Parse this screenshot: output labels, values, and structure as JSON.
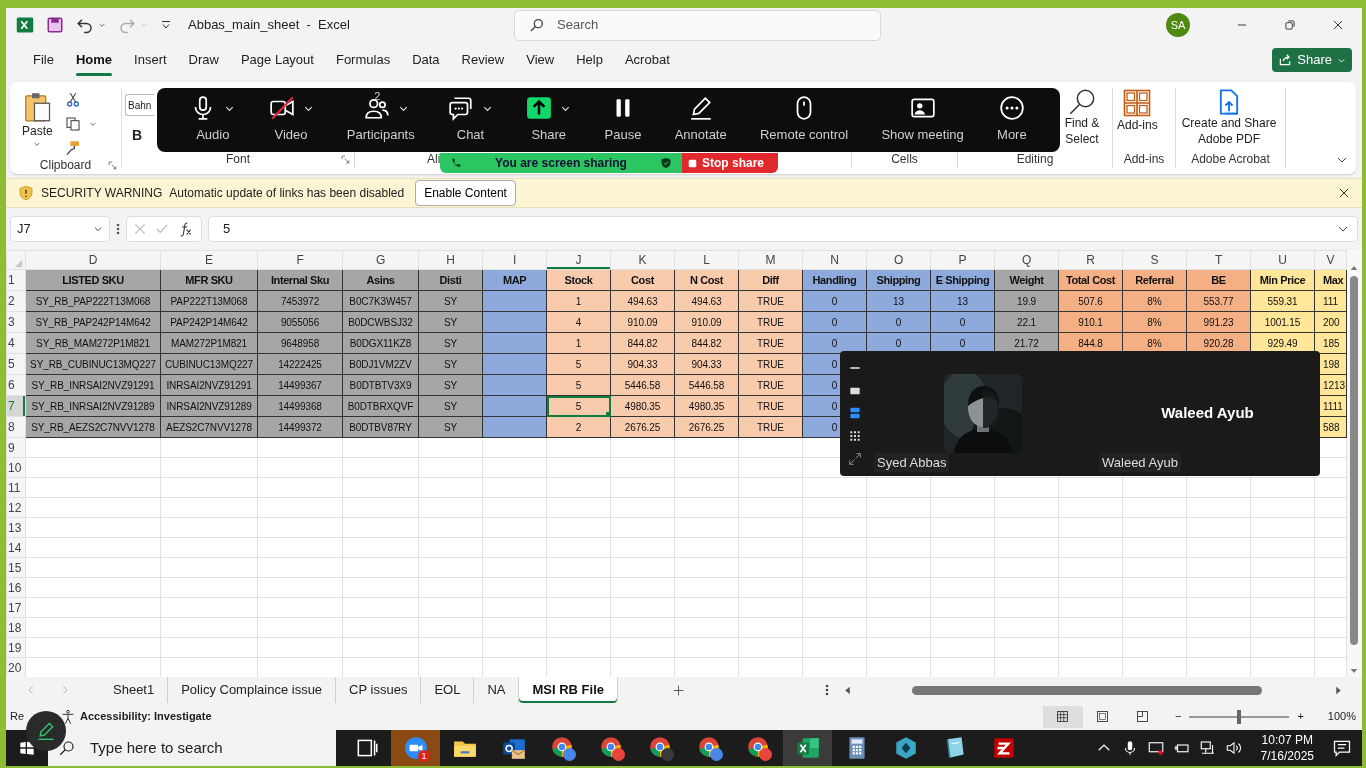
{
  "window": {
    "title": "Abbas_main_sheet  -  Excel",
    "search_placeholder": "Search",
    "account_initials": "SA"
  },
  "ribbon_tabs": [
    {
      "label": "File",
      "selected": false
    },
    {
      "label": "Home",
      "selected": true
    },
    {
      "label": "Insert",
      "selected": false
    },
    {
      "label": "Draw",
      "selected": false
    },
    {
      "label": "Page Layout",
      "selected": false
    },
    {
      "label": "Formulas",
      "selected": false
    },
    {
      "label": "Data",
      "selected": false
    },
    {
      "label": "Review",
      "selected": false
    },
    {
      "label": "View",
      "selected": false
    },
    {
      "label": "Help",
      "selected": false
    },
    {
      "label": "Acrobat",
      "selected": false
    }
  ],
  "share_button": "Share",
  "ribbon_groups": [
    {
      "kind": "clipboard",
      "label": "Clipboard",
      "button": "Paste"
    },
    {
      "kind": "font",
      "label": "Font",
      "font_name": "Bahn",
      "bold_button": "B"
    },
    {
      "kind": "alignment",
      "label": "Ali"
    },
    {
      "kind": "cells",
      "label": "Cells"
    },
    {
      "kind": "editing",
      "label": "Editing",
      "button": "Find & Select"
    },
    {
      "kind": "addins",
      "label": "Add-ins",
      "button": "Add-ins"
    },
    {
      "kind": "acrobat",
      "label": "Adobe Acrobat",
      "button": "Create and Share Adobe PDF"
    }
  ],
  "meeting_controls": {
    "buttons": [
      {
        "kind": "audio",
        "label": "Audio",
        "dropdown": true,
        "off": false
      },
      {
        "kind": "video",
        "label": "Video",
        "dropdown": true,
        "off": true
      },
      {
        "kind": "participants",
        "label": "Participants",
        "dropdown": true,
        "count": "2"
      },
      {
        "kind": "chat",
        "label": "Chat",
        "dropdown": true
      },
      {
        "kind": "share",
        "label": "Share",
        "dropdown": true
      },
      {
        "kind": "pause",
        "label": "Pause",
        "dropdown": false
      },
      {
        "kind": "annotate",
        "label": "Annotate",
        "dropdown": false
      },
      {
        "kind": "remote",
        "label": "Remote control",
        "dropdown": false
      },
      {
        "kind": "show_meeting",
        "label": "Show meeting",
        "dropdown": false
      },
      {
        "kind": "more",
        "label": "More",
        "dropdown": false
      }
    ],
    "sharing_banner": "You are screen sharing",
    "stop_button": "Stop share"
  },
  "security_bar": {
    "title": "SECURITY WARNING",
    "message": "Automatic update of links has been disabled",
    "button": "Enable Content"
  },
  "formula_bar": {
    "name_box": "J7",
    "value": "5"
  },
  "sheet": {
    "columns": [
      {
        "letter": "D",
        "color": "#a6a6a6",
        "selected": false
      },
      {
        "letter": "E",
        "color": "#a6a6a6",
        "selected": false
      },
      {
        "letter": "F",
        "color": "#a6a6a6",
        "selected": false
      },
      {
        "letter": "G",
        "color": "#a6a6a6",
        "selected": false
      },
      {
        "letter": "H",
        "color": "#a6a6a6",
        "selected": false
      },
      {
        "letter": "I",
        "color": "#8ea9db",
        "selected": false
      },
      {
        "letter": "J",
        "color": "#f8cbad",
        "selected": true
      },
      {
        "letter": "K",
        "color": "#f8cbad",
        "selected": false
      },
      {
        "letter": "L",
        "color": "#f8cbad",
        "selected": false
      },
      {
        "letter": "M",
        "color": "#f8cbad",
        "selected": false
      },
      {
        "letter": "N",
        "color": "#8ea9db",
        "selected": false
      },
      {
        "letter": "O",
        "color": "#8ea9db",
        "selected": false
      },
      {
        "letter": "P",
        "color": "#8ea9db",
        "selected": false
      },
      {
        "letter": "Q",
        "color": "#a6a6a6",
        "selected": false
      },
      {
        "letter": "R",
        "color": "#f4b084",
        "selected": false
      },
      {
        "letter": "S",
        "color": "#f4b084",
        "selected": false
      },
      {
        "letter": "T",
        "color": "#f4b084",
        "selected": false
      },
      {
        "letter": "U",
        "color": "#ffe699",
        "selected": false
      },
      {
        "letter": "V",
        "color": "#ffe699",
        "selected": false
      }
    ],
    "rows": [
      {
        "number": "1",
        "kind": "header",
        "selected": false,
        "cells": [
          "LISTED SKU",
          "MFR SKU",
          "Internal Sku",
          "Asins",
          "Disti",
          "MAP",
          "Stock",
          "Cost",
          "N Cost",
          "Diff",
          "Handling",
          "Shipping",
          "E Shipping",
          "Weight",
          "Total Cost",
          "Referral",
          "BE",
          "Min Price",
          "Max"
        ]
      },
      {
        "number": "2",
        "kind": "data",
        "selected": false,
        "cells": [
          "SY_RB_PAP222T13M068",
          "PAP222T13M068",
          "7453972",
          "B0C7K3W457",
          "SY",
          null,
          "1",
          "494.63",
          "494.63",
          "TRUE",
          "0",
          "13",
          "13",
          "19.9",
          "507.6",
          "8%",
          "553.77",
          "559.31",
          "111"
        ]
      },
      {
        "number": "3",
        "kind": "data",
        "selected": false,
        "cells": [
          "SY_RB_PAP242P14M642",
          "PAP242P14M642",
          "9055056",
          "B0DCWBSJ32",
          "SY",
          null,
          "4",
          "910.09",
          "910.09",
          "TRUE",
          "0",
          "0",
          "0",
          "22.1",
          "910.1",
          "8%",
          "991.23",
          "1001.15",
          "200"
        ]
      },
      {
        "number": "4",
        "kind": "data",
        "selected": false,
        "cells": [
          "SY_RB_MAM272P1M821",
          "MAM272P1M821",
          "9648958",
          "B0DGX11KZ8",
          "SY",
          null,
          "1",
          "844.82",
          "844.82",
          "TRUE",
          "0",
          "0",
          "0",
          "21.72",
          "844.8",
          "8%",
          "920.28",
          "929.49",
          "185"
        ]
      },
      {
        "number": "5",
        "kind": "data",
        "selected": false,
        "cells": [
          "SY_RB_CUBINUC13MQ227",
          "CUBINUC13MQ227",
          "14222425",
          "B0DJ1VM2ZV",
          "SY",
          null,
          "5",
          "904.33",
          "904.33",
          "TRUE",
          "0",
          null,
          null,
          null,
          null,
          null,
          null,
          null,
          "198"
        ]
      },
      {
        "number": "6",
        "kind": "data",
        "selected": false,
        "cells": [
          "SY_RB_INRSAI2NVZ91291",
          "INRSAI2NVZ91291",
          "14499367",
          "B0DTBTV3X9",
          "SY",
          null,
          "5",
          "5446.58",
          "5446.58",
          "TRUE",
          "0",
          null,
          null,
          null,
          null,
          null,
          null,
          null,
          "1213"
        ]
      },
      {
        "number": "7",
        "kind": "data",
        "selected": true,
        "cells": [
          "SY_RB_INRSAI2NVZ91289",
          "INRSAI2NVZ91289",
          "14499368",
          "B0DTBRXQVF",
          "SY",
          null,
          "5",
          "4980.35",
          "4980.35",
          "TRUE",
          "0",
          null,
          null,
          null,
          null,
          null,
          null,
          null,
          "1111"
        ]
      },
      {
        "number": "8",
        "kind": "data",
        "selected": false,
        "cells": [
          "SY_RB_AEZS2C7NVV1278",
          "AEZS2C7NVV1278",
          "14499372",
          "B0DTBV87RY",
          "SY",
          null,
          "2",
          "2676.25",
          "2676.25",
          "TRUE",
          "0",
          null,
          null,
          null,
          null,
          null,
          null,
          null,
          "588"
        ]
      },
      {
        "number": "9",
        "kind": "empty",
        "selected": false
      },
      {
        "number": "10",
        "kind": "empty",
        "selected": false
      },
      {
        "number": "11",
        "kind": "empty",
        "selected": false
      },
      {
        "number": "12",
        "kind": "empty",
        "selected": false
      },
      {
        "number": "13",
        "kind": "empty",
        "selected": false
      },
      {
        "number": "14",
        "kind": "empty",
        "selected": false
      },
      {
        "number": "15",
        "kind": "empty",
        "selected": false
      },
      {
        "number": "16",
        "kind": "empty",
        "selected": false
      },
      {
        "number": "17",
        "kind": "empty",
        "selected": false
      },
      {
        "number": "18",
        "kind": "empty",
        "selected": false
      },
      {
        "number": "19",
        "kind": "empty",
        "selected": false
      },
      {
        "number": "20",
        "kind": "empty",
        "selected": false
      }
    ]
  },
  "video_panel": {
    "view_buttons": [
      {
        "kind": "minimize",
        "selected": false
      },
      {
        "kind": "thumbnail",
        "selected": false
      },
      {
        "kind": "speaker",
        "selected": true
      },
      {
        "kind": "gallery",
        "selected": false
      },
      {
        "kind": "fullscreen",
        "selected": false
      }
    ],
    "tiles": [
      {
        "name": "Syed Abbas",
        "video": true
      },
      {
        "name": "Waleed Ayub",
        "video": false,
        "display_name": "Waleed Ayub"
      }
    ]
  },
  "sheet_tabs": [
    {
      "label": "Sheet1",
      "selected": false
    },
    {
      "label": "Policy Complaince issue",
      "selected": false
    },
    {
      "label": "CP issues",
      "selected": false
    },
    {
      "label": "EOL",
      "selected": false
    },
    {
      "label": "NA",
      "selected": false
    },
    {
      "label": "MSI RB File",
      "selected": true
    }
  ],
  "status_bar": {
    "status": "Re",
    "accessibility": "Accessibility: Investigate",
    "views": [
      {
        "kind": "normal",
        "selected": true
      },
      {
        "kind": "page_layout",
        "selected": false
      },
      {
        "kind": "page_break",
        "selected": false
      }
    ],
    "zoom_out": "−",
    "zoom_in": "+",
    "zoom": {
      "level": 0.5,
      "reading": "100%"
    }
  },
  "taskbar": {
    "search_placeholder": "Type here to search",
    "apps": [
      {
        "kind": "task_view",
        "active": false,
        "flashing": false
      },
      {
        "kind": "zoom",
        "active": false,
        "flashing": true,
        "badge": "1"
      },
      {
        "kind": "explorer",
        "active": false,
        "flashing": false
      },
      {
        "kind": "outlook",
        "active": false,
        "flashing": false
      },
      {
        "kind": "chrome",
        "active": false,
        "flashing": false,
        "color": "#4a86e8"
      },
      {
        "kind": "chrome",
        "active": false,
        "flashing": false,
        "color": "#e8453c"
      },
      {
        "kind": "chrome",
        "active": false,
        "flashing": false,
        "color": "#3a3a3a"
      },
      {
        "kind": "chrome",
        "active": false,
        "flashing": false,
        "color": "#4a86e8"
      },
      {
        "kind": "chrome",
        "active": false,
        "flashing": false,
        "color": "#e8453c"
      },
      {
        "kind": "excel",
        "active": true,
        "flashing": false
      },
      {
        "kind": "calculator",
        "active": false,
        "flashing": false
      },
      {
        "kind": "hexagon_app",
        "active": false,
        "flashing": false
      },
      {
        "kind": "notes",
        "active": false,
        "flashing": false
      },
      {
        "kind": "filezilla",
        "active": false,
        "flashing": false
      }
    ],
    "time": "10:07 PM",
    "date": "7/16/2025"
  }
}
